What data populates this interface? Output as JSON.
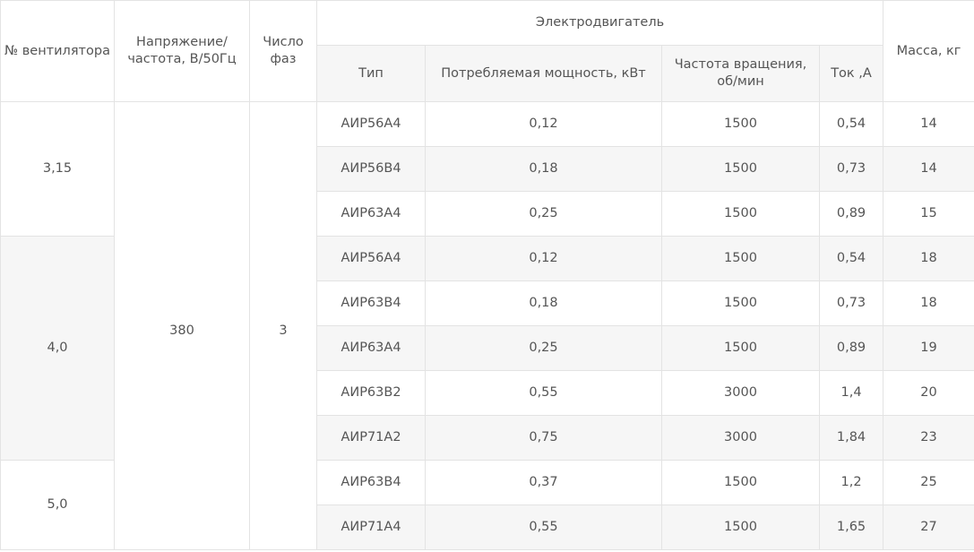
{
  "header": {
    "fan_number": "№ вентилятора",
    "voltage": "Напряжение/ частота, В/50Гц",
    "phases": "Число фаз",
    "motor": "Электродвигатель",
    "mass": "Масса, кг",
    "type": "Тип",
    "power": "Потребляемая мощность, кВт",
    "speed": "Частота вращения, об/мин",
    "current": "Ток ,А"
  },
  "merged": {
    "fan_groups": [
      "3,15",
      "4,0",
      "5,0"
    ],
    "voltage": "380",
    "phases": "3"
  },
  "rows": [
    {
      "type": "АИР56А4",
      "power": "0,12",
      "speed": "1500",
      "current": "0,54",
      "mass": "14"
    },
    {
      "type": "АИР56В4",
      "power": "0,18",
      "speed": "1500",
      "current": "0,73",
      "mass": "14"
    },
    {
      "type": "АИР63А4",
      "power": "0,25",
      "speed": "1500",
      "current": "0,89",
      "mass": "15"
    },
    {
      "type": "АИР56А4",
      "power": "0,12",
      "speed": "1500",
      "current": "0,54",
      "mass": "18"
    },
    {
      "type": "АИР63В4",
      "power": "0,18",
      "speed": "1500",
      "current": "0,73",
      "mass": "18"
    },
    {
      "type": "АИР63А4",
      "power": "0,25",
      "speed": "1500",
      "current": "0,89",
      "mass": "19"
    },
    {
      "type": "АИР63В2",
      "power": "0,55",
      "speed": "3000",
      "current": "1,4",
      "mass": "20"
    },
    {
      "type": "АИР71А2",
      "power": "0,75",
      "speed": "3000",
      "current": "1,84",
      "mass": "23"
    },
    {
      "type": "АИР63В4",
      "power": "0,37",
      "speed": "1500",
      "current": "1,2",
      "mass": "25"
    },
    {
      "type": "АИР71А4",
      "power": "0,55",
      "speed": "1500",
      "current": "1,65",
      "mass": "27"
    }
  ]
}
